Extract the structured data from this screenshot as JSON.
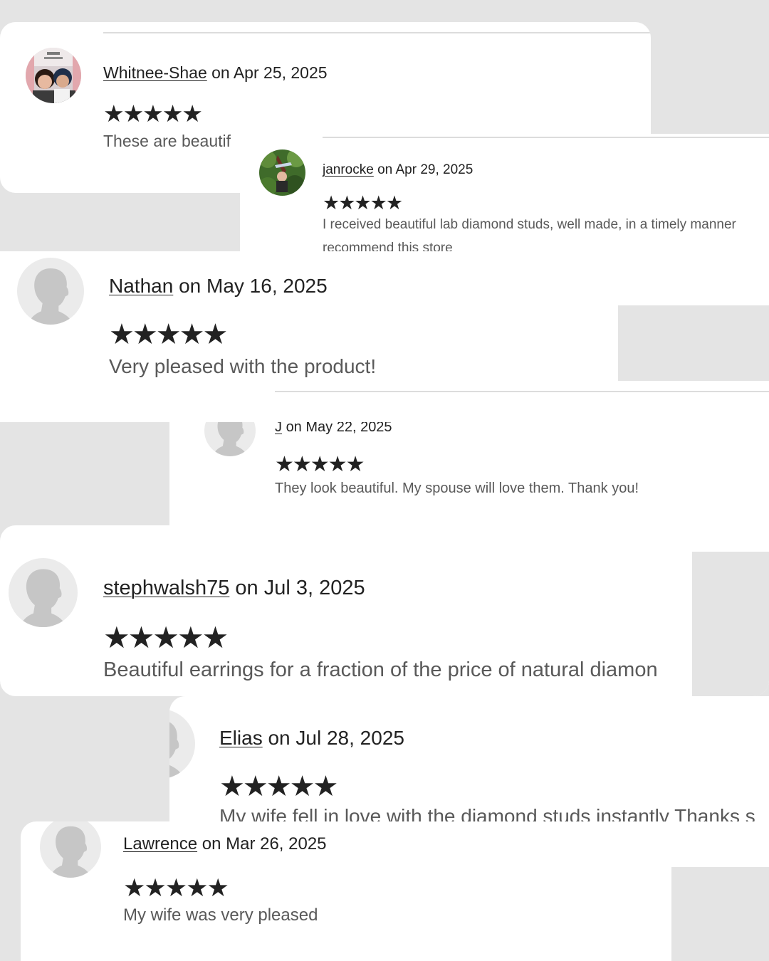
{
  "reviews": [
    {
      "user": "Whitnee-Shae",
      "date": "on Apr 25, 2025",
      "rating": 5,
      "stars": "★★★★★",
      "text": "These are beautif"
    },
    {
      "user": "janrocke",
      "date": "on Apr 29, 2025",
      "rating": 5,
      "stars": "★★★★★",
      "text": "I received beautiful lab diamond studs, well made, in a timely manner",
      "text2": "recommend this store"
    },
    {
      "user": "Nathan",
      "date": "on May 16, 2025",
      "rating": 5,
      "stars": "★★★★★",
      "text": "Very pleased with the product!"
    },
    {
      "user": "J",
      "date": "on May 22, 2025",
      "rating": 5,
      "stars": "★★★★★",
      "text": "They look beautiful. My spouse will love them. Thank you!"
    },
    {
      "user": "stephwalsh75",
      "date": "on Jul 3, 2025",
      "rating": 5,
      "stars": "★★★★★",
      "text": "Beautiful earrings for a fraction of the price of natural diamon"
    },
    {
      "user": "Elias",
      "date": "on Jul 28, 2025",
      "rating": 5,
      "stars": "★★★★★",
      "text": "My wife fell in love with the diamond studs instantly Thanks s"
    },
    {
      "user": "Lawrence",
      "date": "on Mar 26, 2025",
      "rating": 5,
      "stars": "★★★★★",
      "text": "My wife was very pleased"
    }
  ],
  "icons": {
    "default_avatar": "user-silhouette-icon",
    "star": "star-icon"
  },
  "colors": {
    "background": "#e4e4e4",
    "card": "#ffffff",
    "text": "#222222",
    "muted_text": "#595959"
  }
}
